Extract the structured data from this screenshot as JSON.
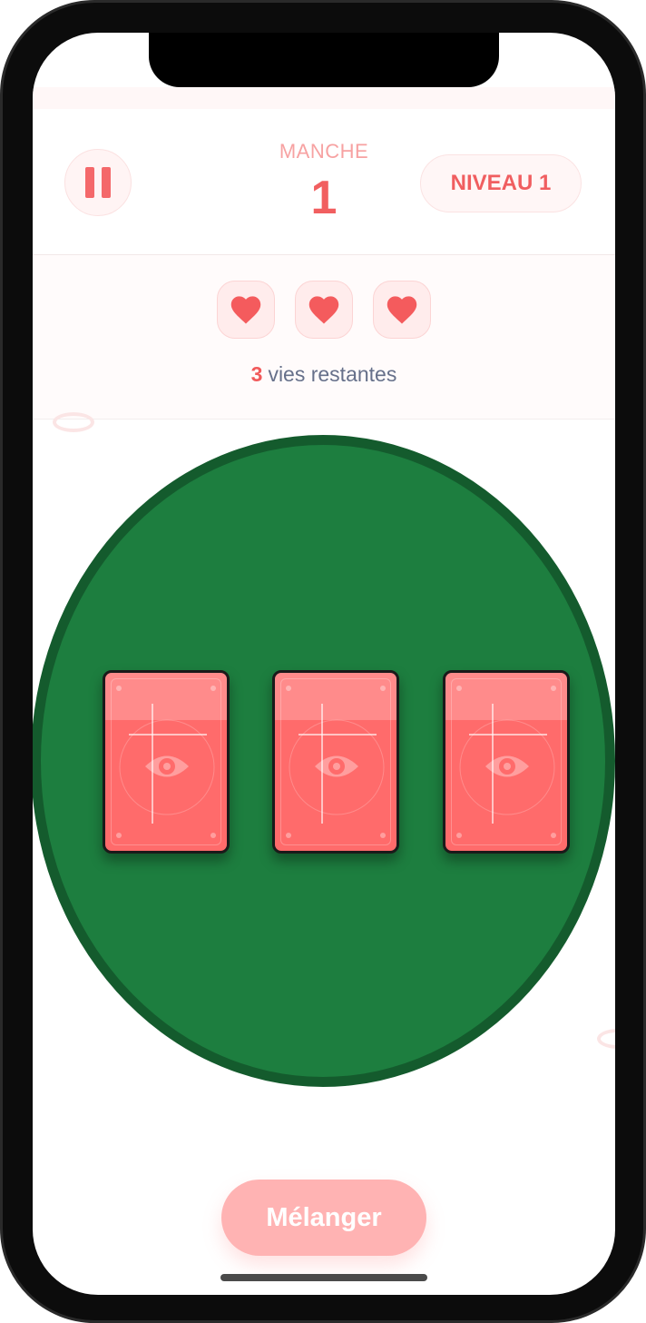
{
  "header": {
    "round_label": "MANCHE",
    "round_value": "1",
    "level_label": "NIVEAU 1",
    "pause_icon": "pause-icon"
  },
  "lives": {
    "count": "3",
    "suffix": "vies restantes",
    "hearts": [
      "heart-icon",
      "heart-icon",
      "heart-icon"
    ]
  },
  "cards": [
    {
      "face": "back",
      "icon": "eye-icon"
    },
    {
      "face": "back",
      "icon": "eye-icon"
    },
    {
      "face": "back",
      "icon": "eye-icon"
    }
  ],
  "actions": {
    "shuffle_label": "Mélanger"
  },
  "colors": {
    "accent": "#f15f60",
    "table": "#1d7e3f",
    "table_border": "#145b2d",
    "card": "#ff6b6b",
    "button": "#ffb3b3"
  }
}
